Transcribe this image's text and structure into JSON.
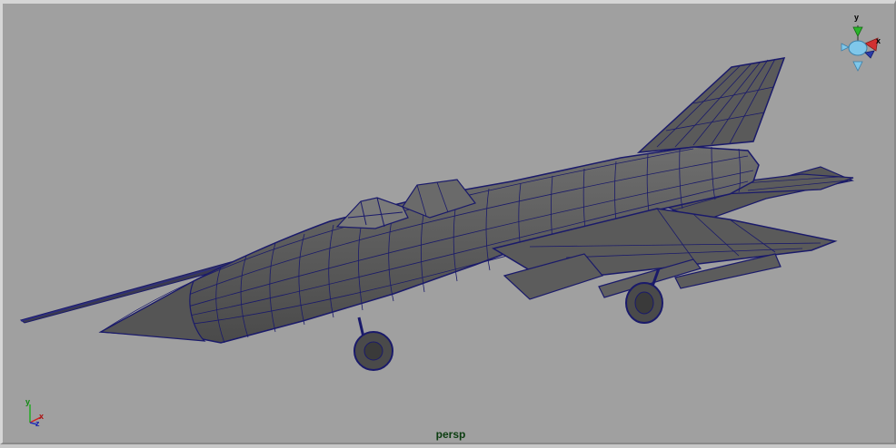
{
  "viewport": {
    "camera_name": "persp",
    "background_color": "#a0a0a0",
    "wireframe_color": "#1a1a6a",
    "shaded_color": "#606060"
  },
  "view_cube": {
    "axis_y": "y",
    "axis_x": "x",
    "axis_z": "z"
  },
  "axis_indicator": {
    "axis_y": "y",
    "axis_x": "x",
    "axis_z": "z"
  },
  "icons": [
    "view-cube-icon",
    "axis-indicator-icon"
  ]
}
